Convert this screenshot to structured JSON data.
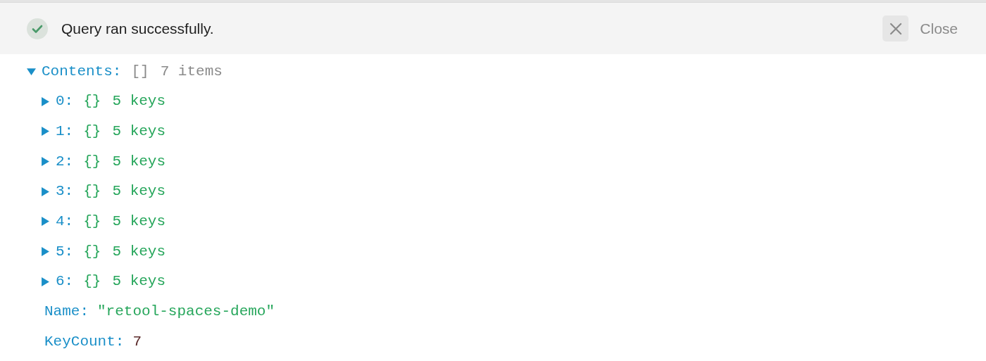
{
  "banner": {
    "message": "Query ran successfully.",
    "close_label": "Close"
  },
  "tree": [
    {
      "key": "Contents:",
      "kind": "node",
      "type": "[]",
      "summary": "7 items",
      "expanded": true,
      "children": [
        {
          "key": "0:",
          "kind": "node",
          "type": "{}",
          "summary": "5 keys",
          "expanded": false
        },
        {
          "key": "1:",
          "kind": "node",
          "type": "{}",
          "summary": "5 keys",
          "expanded": false
        },
        {
          "key": "2:",
          "kind": "node",
          "type": "{}",
          "summary": "5 keys",
          "expanded": false
        },
        {
          "key": "3:",
          "kind": "node",
          "type": "{}",
          "summary": "5 keys",
          "expanded": false
        },
        {
          "key": "4:",
          "kind": "node",
          "type": "{}",
          "summary": "5 keys",
          "expanded": false
        },
        {
          "key": "5:",
          "kind": "node",
          "type": "{}",
          "summary": "5 keys",
          "expanded": false
        },
        {
          "key": "6:",
          "kind": "node",
          "type": "{}",
          "summary": "5 keys",
          "expanded": false
        }
      ]
    },
    {
      "key": "Name:",
      "kind": "string",
      "value": "\"retool-spaces-demo\""
    },
    {
      "key": "KeyCount:",
      "kind": "number",
      "value": "7"
    }
  ]
}
